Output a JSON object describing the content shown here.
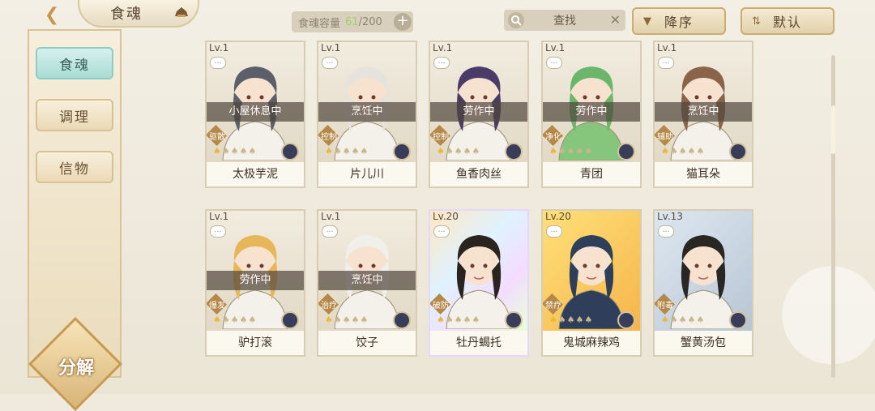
{
  "header": {
    "title": "食魂",
    "capacity_label": "食魂容量",
    "capacity_current": "61",
    "capacity_max": "/200",
    "search_label": "查找",
    "sort_desc_label": "降序",
    "sort_default_label": "默认"
  },
  "sidebar": {
    "tabs": [
      {
        "label": "食魂"
      },
      {
        "label": "调理"
      },
      {
        "label": "信物"
      }
    ],
    "decompose_label": "分解"
  },
  "cards": [
    {
      "level": "Lv.1",
      "status": "小屋休息中",
      "role": "驱散",
      "name": "太极芋泥",
      "stars": 1
    },
    {
      "level": "Lv.1",
      "status": "烹饪中",
      "role": "控制",
      "name": "片儿川",
      "stars": 1
    },
    {
      "level": "Lv.1",
      "status": "劳作中",
      "role": "控制",
      "name": "鱼香肉丝",
      "stars": 1
    },
    {
      "level": "Lv.1",
      "status": "劳作中",
      "role": "净化",
      "name": "青团",
      "stars": 1
    },
    {
      "level": "Lv.1",
      "status": "烹饪中",
      "role": "辅助",
      "name": "猫耳朵",
      "stars": 1
    },
    {
      "level": "Lv.1",
      "status": "劳作中",
      "role": "爆发",
      "name": "驴打滚",
      "stars": 1
    },
    {
      "level": "Lv.1",
      "status": "烹饪中",
      "role": "治疗",
      "name": "饺子",
      "stars": 1
    },
    {
      "level": "Lv.20",
      "status": "",
      "role": "破防",
      "name": "牡丹蝎托",
      "stars": 1
    },
    {
      "level": "Lv.20",
      "status": "",
      "role": "禁疗",
      "name": "鬼城麻辣鸡",
      "stars": 1
    },
    {
      "level": "Lv.13",
      "status": "",
      "role": "附毒",
      "name": "蟹黄汤包",
      "stars": 1
    }
  ],
  "colors": {
    "background": "#efeadd",
    "active_tab": "#a9dcd6",
    "capacity_current": "#9ccf6c"
  }
}
